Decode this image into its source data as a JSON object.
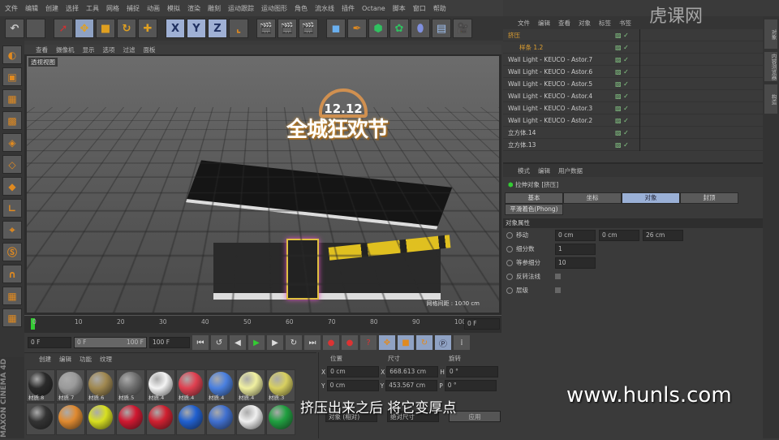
{
  "menu": [
    "文件",
    "编辑",
    "创建",
    "选择",
    "工具",
    "网格",
    "捕捉",
    "动画",
    "模拟",
    "渲染",
    "雕刻",
    "运动跟踪",
    "运动图形",
    "角色",
    "流水线",
    "插件",
    "Octane",
    "脚本",
    "窗口",
    "帮助"
  ],
  "toolbar": {
    "x": "X",
    "y": "Y",
    "z": "Z"
  },
  "viewport": {
    "menu": [
      "查看",
      "摄像机",
      "显示",
      "选项",
      "过滤",
      "面板"
    ],
    "label": "透视视图",
    "info": "网格间距 : 1000 cm",
    "sign_top": "12.12",
    "sign": "全城狂欢节"
  },
  "timeline": {
    "ticks": [
      "0",
      "10",
      "20",
      "30",
      "40",
      "50",
      "60",
      "70",
      "80",
      "90",
      "100"
    ],
    "end_field": "0 F"
  },
  "transport": {
    "start": "0 F",
    "range_start": "0 F",
    "range_end": "100 F",
    "end": "100 F"
  },
  "materials": {
    "menu": [
      "创建",
      "编辑",
      "功能",
      "纹理"
    ],
    "items": [
      {
        "name": "材质.8",
        "color": "#2a2a2a"
      },
      {
        "name": "材质.7",
        "color": "#9a9a9a"
      },
      {
        "name": "材质.6",
        "color": "#a08850"
      },
      {
        "name": "材质.5",
        "color": "#707070"
      },
      {
        "name": "材质.4",
        "color": "#f4f4f4"
      },
      {
        "name": "材质.4",
        "color": "#e04050"
      },
      {
        "name": "材质.4",
        "color": "#4a80e0"
      },
      {
        "name": "材质.4",
        "color": "#f0f0a0"
      },
      {
        "name": "材质.3",
        "color": "#d8d060"
      },
      {
        "name": "",
        "color": "#333"
      },
      {
        "name": "",
        "color": "#e08a30"
      },
      {
        "name": "",
        "color": "#d8e020"
      },
      {
        "name": "",
        "color": "#d01830"
      },
      {
        "name": "",
        "color": "#d02030"
      },
      {
        "name": "",
        "color": "#2060d0"
      },
      {
        "name": "",
        "color": "#4070d0"
      },
      {
        "name": "",
        "color": "#f0f0f0"
      },
      {
        "name": "",
        "color": "#20a040"
      }
    ]
  },
  "coords": {
    "headers": [
      "位置",
      "尺寸",
      "旋转"
    ],
    "rows": [
      {
        "a": "X",
        "pos": "0 cm",
        "b": "X",
        "size": "668.613 cm",
        "c": "H",
        "rot": "0 °"
      },
      {
        "a": "Y",
        "pos": "0 cm",
        "b": "Y",
        "size": "453.567 cm",
        "c": "P",
        "rot": "0 °"
      }
    ],
    "mode": "对象 (相对)",
    "size_mode": "绝对尺寸",
    "apply": "应用"
  },
  "object_manager": {
    "menu": [
      "文件",
      "编辑",
      "查看",
      "对象",
      "标签",
      "书签"
    ],
    "items": [
      {
        "name": "挤压",
        "hl": true
      },
      {
        "name": "样条 1.2",
        "hl": true
      },
      {
        "name": "Wall Light - KEUCO - Astor.7"
      },
      {
        "name": "Wall Light - KEUCO - Astor.6"
      },
      {
        "name": "Wall Light - KEUCO - Astor.5"
      },
      {
        "name": "Wall Light - KEUCO - Astor.4"
      },
      {
        "name": "Wall Light - KEUCO - Astor.3"
      },
      {
        "name": "Wall Light - KEUCO - Astor.2"
      },
      {
        "name": "立方体.14"
      },
      {
        "name": "立方体.13"
      }
    ]
  },
  "attributes": {
    "menu": [
      "模式",
      "编辑",
      "用户数据"
    ],
    "title": "拉伸对象 [挤压]",
    "tabs": [
      "基本",
      "坐标",
      "对象",
      "封顶"
    ],
    "active_tab": "对象",
    "phong": "平滑着色(Phong)",
    "section": "对象属性",
    "fields": [
      {
        "label": "移动",
        "values": [
          "0 cm",
          "0 cm",
          "26 cm"
        ]
      },
      {
        "label": "细分数",
        "values": [
          "1"
        ]
      },
      {
        "label": "等参细分",
        "values": [
          "10"
        ]
      },
      {
        "label": "反转法线",
        "values": []
      },
      {
        "label": "层级",
        "values": []
      }
    ]
  },
  "side_tabs": [
    "对象",
    "内容浏览器",
    "构造"
  ],
  "brand": "MAXON CINEMA 4D",
  "subtitle": "挤压出来之后 将它变厚点",
  "watermark": "www.hunls.com",
  "logo": "虎课网"
}
